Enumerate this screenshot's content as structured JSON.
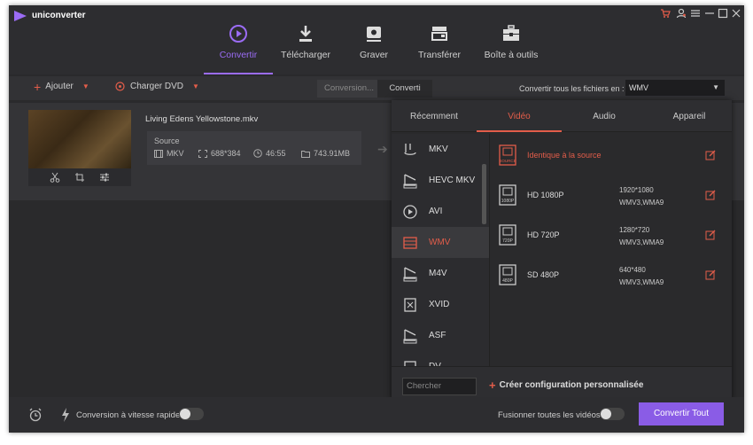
{
  "app": {
    "name": "uniconverter"
  },
  "colors": {
    "accent_purple": "#9b6cf5",
    "accent_red": "#e35d4a",
    "background": "#2a2a2c",
    "button_purple": "#8a5ce6"
  },
  "window_controls": [
    "cart-icon",
    "user-icon",
    "menu-icon",
    "minimize-icon",
    "maximize-icon",
    "close-icon"
  ],
  "nav": [
    {
      "label": "Convertir",
      "icon": "convert-icon",
      "active": true
    },
    {
      "label": "Télécharger",
      "icon": "download-icon",
      "active": false
    },
    {
      "label": "Graver",
      "icon": "burn-disc-icon",
      "active": false
    },
    {
      "label": "Transférer",
      "icon": "transfer-icon",
      "active": false
    },
    {
      "label": "Boîte à outils",
      "icon": "toolbox-icon",
      "active": false
    }
  ],
  "toolbar": {
    "add_label": "Ajouter",
    "dvd_label": "Charger DVD",
    "seg_converting": "Conversion...",
    "seg_converted": "Converti",
    "convert_all_label": "Convertir tous les fichiers en :",
    "format_value": "WMV"
  },
  "file": {
    "name": "Living Edens Yellowstone.mkv",
    "source_label": "Source",
    "format": "MKV",
    "resolution": "688*384",
    "duration": "46:55",
    "size": "743.91MB"
  },
  "popup": {
    "tabs": [
      {
        "label": "Récemment",
        "active": false
      },
      {
        "label": "Vidéo",
        "active": true
      },
      {
        "label": "Audio",
        "active": false
      },
      {
        "label": "Appareil",
        "active": false
      }
    ],
    "formats": [
      {
        "label": "MKV",
        "icon": "mkv-icon",
        "active": false
      },
      {
        "label": "HEVC MKV",
        "icon": "hevc-icon",
        "active": false
      },
      {
        "label": "AVI",
        "icon": "avi-icon",
        "active": false
      },
      {
        "label": "WMV",
        "icon": "wmv-icon",
        "active": true
      },
      {
        "label": "M4V",
        "icon": "m4v-icon",
        "active": false
      },
      {
        "label": "XVID",
        "icon": "xvid-icon",
        "active": false
      },
      {
        "label": "ASF",
        "icon": "asf-icon",
        "active": false
      },
      {
        "label": "DV",
        "icon": "dv-icon",
        "active": false
      }
    ],
    "presets": [
      {
        "name": "Identique à la source",
        "badge": "SOURCE",
        "res": "",
        "codec": "",
        "active": true
      },
      {
        "name": "HD 1080P",
        "badge": "1080P",
        "res": "1920*1080",
        "codec": "WMV3,WMA9",
        "active": false
      },
      {
        "name": "HD 720P",
        "badge": "720P",
        "res": "1280*720",
        "codec": "WMV3,WMA9",
        "active": false
      },
      {
        "name": "SD 480P",
        "badge": "480P",
        "res": "640*480",
        "codec": "WMV3,WMA9",
        "active": false
      }
    ],
    "search_placeholder": "Chercher",
    "create_label": "Créer configuration personnalisée"
  },
  "bottom": {
    "fast_label": "Conversion à vitesse rapide",
    "merge_label": "Fusionner toutes les vidéos",
    "convert_all_button": "Convertir Tout"
  }
}
